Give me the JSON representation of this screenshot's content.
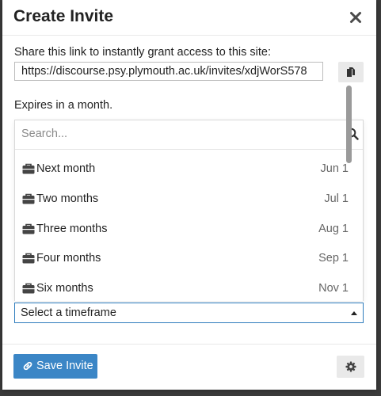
{
  "modal": {
    "title": "Create Invite",
    "close_icon": "close-icon"
  },
  "share": {
    "label": "Share this link to instantly grant access to this site:",
    "link_value": "https://discourse.psy.plymouth.ac.uk/invites/xdjWorS578",
    "copy_icon": "copy-icon"
  },
  "expires": {
    "label": "Expires in a month."
  },
  "timeframe_dropdown": {
    "search_placeholder": "Search...",
    "search_icon": "search-icon",
    "option_icon": "briefcase-icon",
    "options": [
      {
        "label": "Next month",
        "date": "Jun 1"
      },
      {
        "label": "Two months",
        "date": "Jul 1"
      },
      {
        "label": "Three months",
        "date": "Aug 1"
      },
      {
        "label": "Four months",
        "date": "Sep 1"
      },
      {
        "label": "Six months",
        "date": "Nov 1"
      }
    ],
    "selected_text": "Select a timeframe",
    "caret_icon": "caret-up-icon"
  },
  "footer": {
    "save_label": "Save Invite",
    "save_icon": "link-icon",
    "settings_icon": "gear-icon"
  },
  "colors": {
    "primary": "#3b86c6",
    "focus_border": "#2f7dbd",
    "backdrop": "#3b3b3b"
  }
}
